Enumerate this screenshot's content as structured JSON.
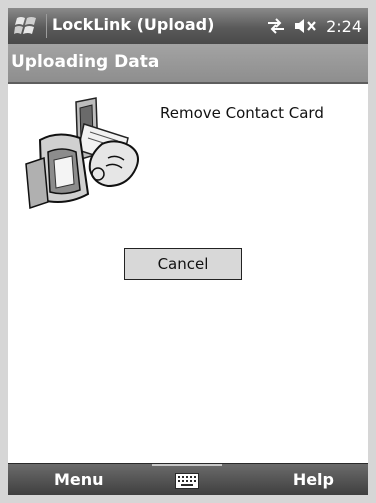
{
  "title_bar": {
    "app_title": "LockLink (Upload)",
    "start_icon": "windows-flag-icon",
    "connectivity_icon": "sync-arrows-icon",
    "volume_icon": "speaker-muted-icon",
    "time": "2:24"
  },
  "caption": {
    "title": "Uploading Data"
  },
  "content": {
    "illustration_icon": "card-removal-illustration",
    "message": "Remove Contact Card",
    "cancel_label": "Cancel"
  },
  "softkeys": {
    "left_label": "Menu",
    "right_label": "Help",
    "sip_icon": "keyboard-icon"
  },
  "colors": {
    "title_bar": "#5a5a5a",
    "caption_bar": "#9a9a9a",
    "softkey_bar": "#4a4a4a",
    "button_face": "#d8d8d8",
    "background": "#ffffff"
  }
}
